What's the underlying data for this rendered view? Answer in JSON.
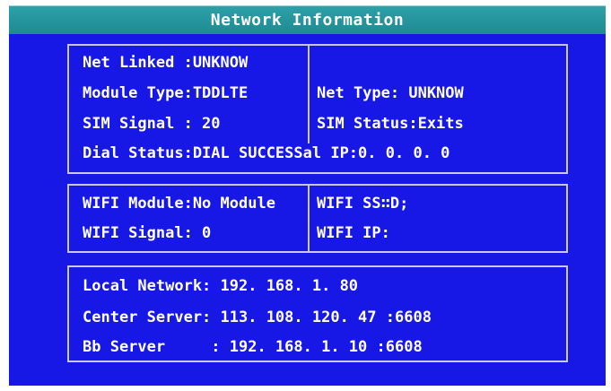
{
  "window": {
    "title": "Network Information"
  },
  "network": {
    "net_linked": "Net Linked :UNKNOW",
    "module_type": "Module Type:TDDLTE",
    "net_type": "Net Type: UNKNOW",
    "sim_signal": "SIM Signal : 20",
    "sim_status": "SIM Status:Exits",
    "dial_status": "Dial Status:DIAL SUCCESSal IP:0. 0. 0. 0"
  },
  "wifi": {
    "module": "WIFI Module:No Module",
    "ssid": "WIFI SS∷D;",
    "signal": "WIFI Signal: 0",
    "ip": "WIFI IP:"
  },
  "servers": {
    "local_network": "Local Network: 192. 168. 1. 80",
    "center_server": "Center Server: 113. 108. 120. 47 :6608",
    "bb_server": "Bb Server     : 192. 168. 1. 10 :6608"
  },
  "colors": {
    "panel_blue": "#1818e6",
    "title_teal": "#2ea0a8",
    "border": "#c9c9ee",
    "text": "#ffffff"
  }
}
